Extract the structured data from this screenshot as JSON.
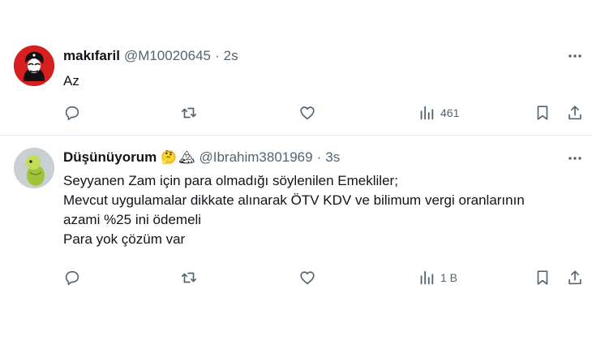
{
  "tweets": [
    {
      "display_name": "makıfaril",
      "handle": "@M10020645",
      "separator": "·",
      "time": "2s",
      "emojis": [],
      "body": [
        "Az"
      ],
      "views": "461",
      "avatar_icon": "profile-avatar-che-icon"
    },
    {
      "display_name": "Düşünüyorum",
      "handle": "@Ibrahim3801969",
      "separator": "·",
      "time": "3s",
      "emojis": [
        "🤔",
        "🏔"
      ],
      "body": [
        "Seyyanen Zam için para olmadığı söylenilen Emekliler;",
        "Mevcut uygulamalar dikkate alınarak ÖTV KDV ve bilimum vergi oranlarının",
        "azami %25 ini ödemeli",
        "Para yok çözüm var"
      ],
      "views": "1 B",
      "avatar_icon": "profile-avatar-budgie-icon"
    }
  ],
  "colors": {
    "text": "#0f1419",
    "muted": "#536471",
    "divider": "#e6e9ec"
  }
}
